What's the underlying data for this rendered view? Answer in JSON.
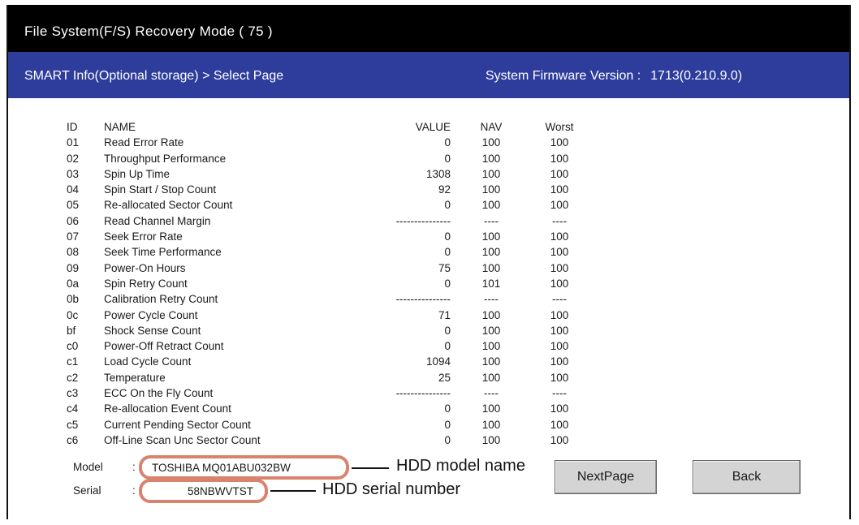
{
  "window": {
    "title": "File System(F/S) Recovery Mode ( 75 )"
  },
  "header": {
    "breadcrumb": "SMART Info(Optional storage) > Select Page",
    "firmware_label": "System Firmware Version :",
    "firmware_value": "1713(0.210.9.0)"
  },
  "table": {
    "columns": [
      "ID",
      "NAME",
      "VALUE",
      "NAV",
      "Worst"
    ],
    "rows": [
      {
        "id": "01",
        "name": "Read Error Rate",
        "value": "0",
        "nav": "100",
        "worst": "100"
      },
      {
        "id": "02",
        "name": "Throughput Performance",
        "value": "0",
        "nav": "100",
        "worst": "100"
      },
      {
        "id": "03",
        "name": "Spin Up Time",
        "value": "1308",
        "nav": "100",
        "worst": "100"
      },
      {
        "id": "04",
        "name": "Spin Start / Stop Count",
        "value": "92",
        "nav": "100",
        "worst": "100"
      },
      {
        "id": "05",
        "name": "Re-allocated Sector Count",
        "value": "0",
        "nav": "100",
        "worst": "100"
      },
      {
        "id": "06",
        "name": "Read Channel Margin",
        "value": "---------------",
        "nav": "----",
        "worst": "----"
      },
      {
        "id": "07",
        "name": "Seek Error Rate",
        "value": "0",
        "nav": "100",
        "worst": "100"
      },
      {
        "id": "08",
        "name": "Seek Time Performance",
        "value": "0",
        "nav": "100",
        "worst": "100"
      },
      {
        "id": "09",
        "name": "Power-On Hours",
        "value": "75",
        "nav": "100",
        "worst": "100"
      },
      {
        "id": "0a",
        "name": "Spin Retry Count",
        "value": "0",
        "nav": "101",
        "worst": "100"
      },
      {
        "id": "0b",
        "name": "Calibration Retry Count",
        "value": "---------------",
        "nav": "----",
        "worst": "----"
      },
      {
        "id": "0c",
        "name": "Power Cycle Count",
        "value": "71",
        "nav": "100",
        "worst": "100"
      },
      {
        "id": "bf",
        "name": "Shock Sense Count",
        "value": "0",
        "nav": "100",
        "worst": "100"
      },
      {
        "id": "c0",
        "name": "Power-Off Retract Count",
        "value": "0",
        "nav": "100",
        "worst": "100"
      },
      {
        "id": "c1",
        "name": "Load Cycle Count",
        "value": "1094",
        "nav": "100",
        "worst": "100"
      },
      {
        "id": "c2",
        "name": "Temperature",
        "value": "25",
        "nav": "100",
        "worst": "100"
      },
      {
        "id": "c3",
        "name": "ECC On the Fly Count",
        "value": "---------------",
        "nav": "----",
        "worst": "----"
      },
      {
        "id": "c4",
        "name": "Re-allocation Event Count",
        "value": "0",
        "nav": "100",
        "worst": "100"
      },
      {
        "id": "c5",
        "name": "Current Pending Sector Count",
        "value": "0",
        "nav": "100",
        "worst": "100"
      },
      {
        "id": "c6",
        "name": "Off-Line Scan Unc Sector Count",
        "value": "0",
        "nav": "100",
        "worst": "100"
      }
    ]
  },
  "device": {
    "model_label": "Model",
    "model_value": "TOSHIBA MQ01ABU032BW",
    "serial_label": "Serial",
    "serial_value": "58NBWVTST",
    "separator": ":"
  },
  "annotations": {
    "model_callout": "HDD model name",
    "serial_callout": "HDD serial number",
    "highlight_color": "#d9826e"
  },
  "buttons": {
    "next_label": "NextPage",
    "back_label": "Back"
  },
  "colors": {
    "title_bg": "#000000",
    "subbar_bg": "#2e3d9c",
    "button_bg": "#d4d4d4"
  }
}
